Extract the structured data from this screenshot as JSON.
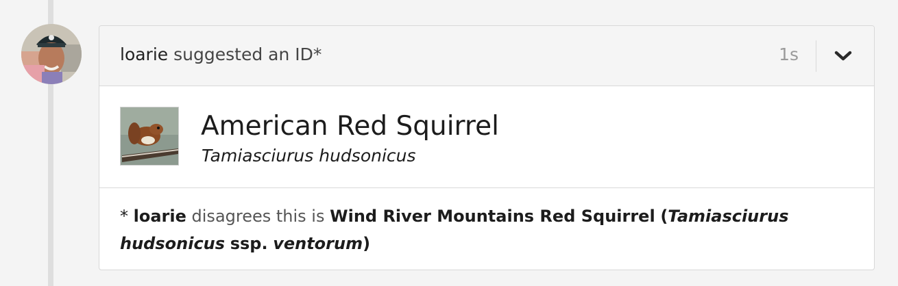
{
  "identification": {
    "username": "loarie",
    "action_text": "suggested an ID*",
    "timestamp": "1s",
    "menu_icon": "chevron-down-icon",
    "avatar_icon": "user-avatar"
  },
  "taxon": {
    "common_name": "American Red Squirrel",
    "scientific_name": "Tamiasciurus hudsonicus",
    "photo_icon": "squirrel-photo"
  },
  "disagreement": {
    "asterisk": "*",
    "username": "loarie",
    "text": "disagrees this is",
    "taxon_common": "Wind River Mountains Red Squirrel",
    "open_paren": "(",
    "taxon_sci": "Tamiasciurus hudsonicus",
    "rank": "ssp.",
    "subspecies": "ventorum",
    "close_paren": ")"
  },
  "colors": {
    "background": "#f4f4f4",
    "card": "#ffffff",
    "header": "#f5f5f5",
    "border": "#d8d8d8",
    "timestamp": "#9a9a9a"
  }
}
